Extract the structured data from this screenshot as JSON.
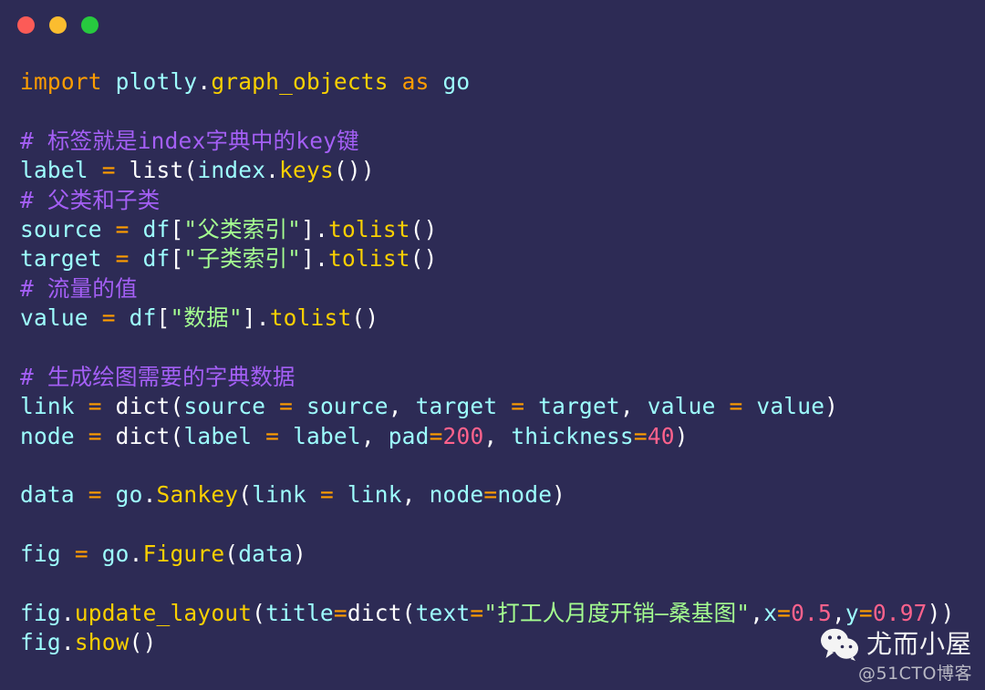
{
  "window": {
    "background_color": "#2d2b55",
    "traffic_lights": [
      {
        "name": "close",
        "color": "#fc5b57"
      },
      {
        "name": "minimize",
        "color": "#fbbd2f"
      },
      {
        "name": "maximize",
        "color": "#27c93f"
      }
    ]
  },
  "theme": {
    "keyword": "#ff9d00",
    "variable": "#9effff",
    "function": "#fad000",
    "punctuation": "#ffffff",
    "string": "#a5ff90",
    "number": "#ff628c",
    "comment": "#a45ff5"
  },
  "code": {
    "language": "python",
    "lines": [
      "import plotly.graph_objects as go",
      "",
      "# 标签就是index字典中的key键",
      "label = list(index.keys())",
      "# 父类和子类",
      "source = df[\"父类索引\"].tolist()",
      "target = df[\"子类索引\"].tolist()",
      "# 流量的值",
      "value = df[\"数据\"].tolist()",
      "",
      "# 生成绘图需要的字典数据",
      "link = dict(source = source, target = target, value = value)",
      "node = dict(label = label, pad=200, thickness=40)",
      "",
      "data = go.Sankey(link = link, node=node)",
      "",
      "fig = go.Figure(data)",
      "",
      "fig.update_layout(title=dict(text=\"打工人月度开销—桑基图\",x=0.5,y=0.97))",
      "fig.show()"
    ],
    "tokens": {
      "l1": {
        "import": "import",
        "module": "plotly",
        "dot": ".",
        "submodule": "graph_objects",
        "as": "as",
        "alias": "go"
      },
      "l3": {
        "comment": "# 标签就是index字典中的key键"
      },
      "l4": {
        "name": "label",
        "eq": "=",
        "fn": "list",
        "open": "(",
        "arg": "index",
        "dot": ".",
        "method": "keys",
        "call": "()",
        "close": ")"
      },
      "l5": {
        "comment": "# 父类和子类"
      },
      "l6": {
        "name": "source",
        "eq": "=",
        "obj": "df",
        "lb": "[",
        "str": "\"父类索引\"",
        "rb": "]",
        "dot": ".",
        "method": "tolist",
        "call": "()"
      },
      "l7": {
        "name": "target",
        "eq": "=",
        "obj": "df",
        "lb": "[",
        "str": "\"子类索引\"",
        "rb": "]",
        "dot": ".",
        "method": "tolist",
        "call": "()"
      },
      "l8": {
        "comment": "# 流量的值"
      },
      "l9": {
        "name": "value",
        "eq": "=",
        "obj": "df",
        "lb": "[",
        "str": "\"数据\"",
        "rb": "]",
        "dot": ".",
        "method": "tolist",
        "call": "()"
      },
      "l11": {
        "comment": "# 生成绘图需要的字典数据"
      },
      "l12": {
        "name": "link",
        "eq": "=",
        "fn": "dict",
        "k1": "source",
        "v1": "source",
        "k2": "target",
        "v2": "target",
        "k3": "value",
        "v3": "value"
      },
      "l13": {
        "name": "node",
        "eq": "=",
        "fn": "dict",
        "k1": "label",
        "v1": "label",
        "k2": "pad",
        "v2": "200",
        "k3": "thickness",
        "v3": "40"
      },
      "l15": {
        "name": "data",
        "eq": "=",
        "mod": "go",
        "fn": "Sankey",
        "k1": "link",
        "v1": "link",
        "k2": "node",
        "v2": "node"
      },
      "l17": {
        "name": "fig",
        "eq": "=",
        "mod": "go",
        "fn": "Figure",
        "arg": "data"
      },
      "l19": {
        "obj": "fig",
        "method": "update_layout",
        "k1": "title",
        "fn": "dict",
        "k2": "text",
        "title_text": "\"打工人月度开销—桑基图\"",
        "k3": "x",
        "v3": "0.5",
        "k4": "y",
        "v4": "0.97"
      },
      "l20": {
        "obj": "fig",
        "method": "show",
        "call": "()"
      }
    }
  },
  "watermark": {
    "icon": "wechat-icon",
    "name": "尤而小屋",
    "source": "@51CTO博客"
  }
}
